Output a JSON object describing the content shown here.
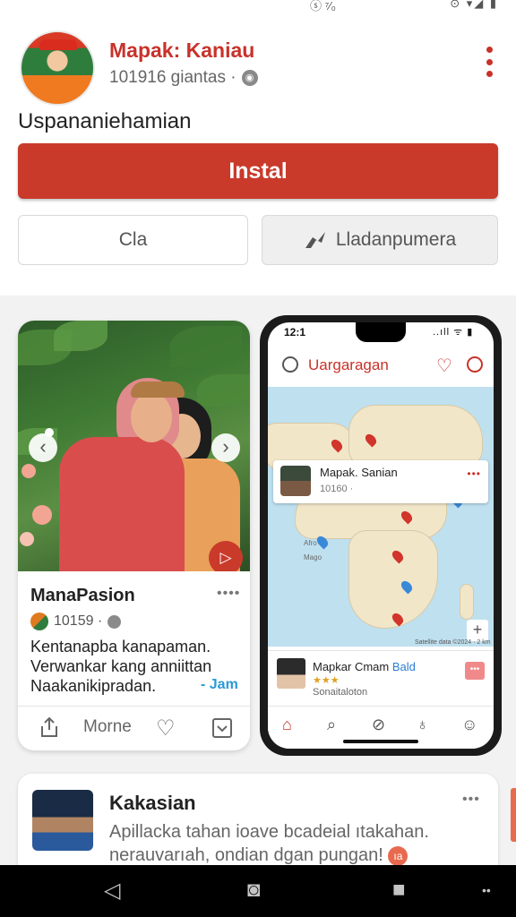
{
  "status_bar": {
    "left": "ⓢ ⁷⁄₀",
    "right": "⊙ ▾◢ ▮"
  },
  "app": {
    "title": "Mapak: Kaniau",
    "meta": "101916 giantas ·",
    "subtitle": "Uspananiehamian",
    "install_label": "Instal",
    "secondary_left_label": "Cla",
    "secondary_right_label": "Lladanpumera"
  },
  "card_left": {
    "title": "ManaPasion",
    "meta": "10159 ·",
    "more": "••••",
    "body_lines": [
      "Kentanapba kanapaman.",
      "Verwankar kang anniittan",
      "Naakanikipradan."
    ],
    "tag": "- Jam",
    "action_more": "Morne"
  },
  "phone": {
    "time": "12:1",
    "status": "..ıll ᯤ ▮",
    "title": "Uargaragan",
    "map_card": {
      "name": "Mapak. Sanian",
      "meta": "10160 ·",
      "more": "•••"
    },
    "map_labels": [
      "Afro",
      "Mago"
    ],
    "attribution": "Satellite data ©2024 · 2 km",
    "result": {
      "name": "Mapkar Cmam",
      "name_blue": "Bald",
      "stars": "★★★",
      "sub": "Sonaitaloton",
      "btn": "•••"
    }
  },
  "card_bottom": {
    "title": "Kakasian",
    "more": "•••",
    "text_line1": "Apillacka  tahan ioave bcadeial ıtakahan.",
    "text_line2": "nerauvarıah, ondian dgan pungan!",
    "badge": "ıа"
  },
  "colors": {
    "accent": "#c93a2b",
    "link": "#2a9ad6"
  }
}
